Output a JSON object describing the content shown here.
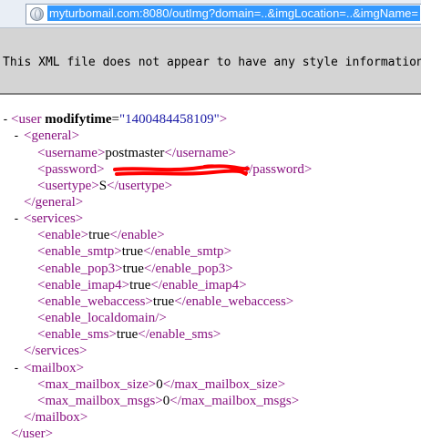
{
  "address_bar": {
    "url": "myturbomail.com:8080/outImg?domain=..&imgLocation=..&imgName="
  },
  "notice": "This XML file does not appear to have any style information",
  "xml": {
    "root_tag": "user",
    "root_attr_name": "modifytime",
    "root_attr_value": "\"1400484458109\"",
    "general_tag": "general",
    "username_tag": "username",
    "username_value": "postmaster",
    "password_tag": "password",
    "usertype_tag": "usertype",
    "usertype_value": "S",
    "services_tag": "services",
    "enable_tag": "enable",
    "enable_value": "true",
    "enable_smtp_tag": "enable_smtp",
    "enable_smtp_value": "true",
    "enable_pop3_tag": "enable_pop3",
    "enable_pop3_value": "true",
    "enable_imap4_tag": "enable_imap4",
    "enable_imap4_value": "true",
    "enable_webaccess_tag": "enable_webaccess",
    "enable_webaccess_value": "true",
    "enable_localdomain_tag": "enable_localdomain",
    "enable_sms_tag": "enable_sms",
    "enable_sms_value": "true",
    "mailbox_tag": "mailbox",
    "max_mailbox_size_tag": "max_mailbox_size",
    "max_mailbox_size_value": "0",
    "max_mailbox_msgs_tag": "max_mailbox_msgs",
    "max_mailbox_msgs_value": "0"
  },
  "toggles": {
    "glyph": "-"
  },
  "colors": {
    "tag": "#881280",
    "attr_value": "#1a1aa6",
    "redaction": "#ff0000",
    "url_highlight": "#3399ff"
  }
}
